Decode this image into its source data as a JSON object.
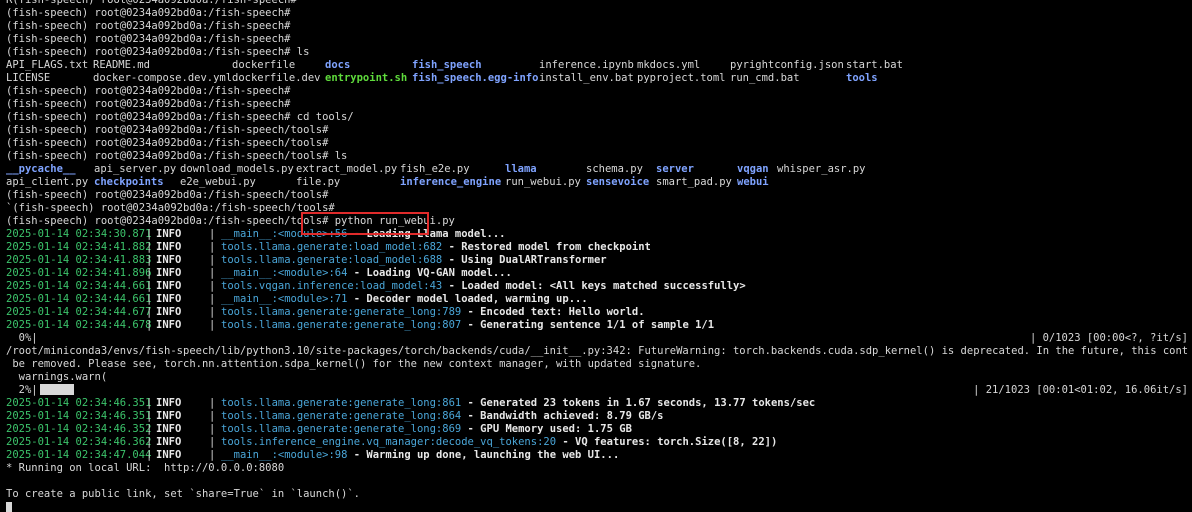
{
  "prompt_lines": [
    "R(fish-speech) root@0234a092bd0a:/fish-speech#",
    "(fish-speech) root@0234a092bd0a:/fish-speech#",
    "(fish-speech) root@0234a092bd0a:/fish-speech#",
    "(fish-speech) root@0234a092bd0a:/fish-speech#",
    "(fish-speech) root@0234a092bd0a:/fish-speech# ls"
  ],
  "ls1": [
    [
      {
        "t": "API_FLAGS.txt",
        "k": "file"
      },
      {
        "t": "README.md",
        "k": "file"
      },
      {
        "t": "dockerfile",
        "k": "file"
      },
      {
        "t": "docs",
        "k": "dir"
      },
      {
        "t": "fish_speech",
        "k": "dir"
      },
      {
        "t": "inference.ipynb",
        "k": "file"
      },
      {
        "t": "mkdocs.yml",
        "k": "file"
      },
      {
        "t": "pyrightconfig.json",
        "k": "file"
      },
      {
        "t": "start.bat",
        "k": "file"
      }
    ],
    [
      {
        "t": "LICENSE",
        "k": "file"
      },
      {
        "t": "docker-compose.dev.yml",
        "k": "file"
      },
      {
        "t": "dockerfile.dev",
        "k": "file"
      },
      {
        "t": "entrypoint.sh",
        "k": "exe"
      },
      {
        "t": "fish_speech.egg-info",
        "k": "dir"
      },
      {
        "t": "install_env.bat",
        "k": "file"
      },
      {
        "t": "pyproject.toml",
        "k": "file"
      },
      {
        "t": "run_cmd.bat",
        "k": "file"
      },
      {
        "t": "tools",
        "k": "dir"
      }
    ]
  ],
  "prompt_lines2": [
    "(fish-speech) root@0234a092bd0a:/fish-speech#",
    "(fish-speech) root@0234a092bd0a:/fish-speech#",
    "(fish-speech) root@0234a092bd0a:/fish-speech# cd tools/",
    "(fish-speech) root@0234a092bd0a:/fish-speech/tools#",
    "(fish-speech) root@0234a092bd0a:/fish-speech/tools#",
    "(fish-speech) root@0234a092bd0a:/fish-speech/tools# ls"
  ],
  "ls2": [
    [
      {
        "t": "__pycache__",
        "k": "dir"
      },
      {
        "t": "api_server.py",
        "k": "file"
      },
      {
        "t": "download_models.py",
        "k": "file"
      },
      {
        "t": "extract_model.py",
        "k": "file"
      },
      {
        "t": "fish_e2e.py",
        "k": "file"
      },
      {
        "t": "llama",
        "k": "dir"
      },
      {
        "t": "schema.py",
        "k": "file"
      },
      {
        "t": "server",
        "k": "dir"
      },
      {
        "t": "vqgan",
        "k": "dir"
      },
      {
        "t": "whisper_asr.py",
        "k": "file"
      }
    ],
    [
      {
        "t": "api_client.py",
        "k": "file"
      },
      {
        "t": "checkpoints",
        "k": "dir"
      },
      {
        "t": "e2e_webui.py",
        "k": "file"
      },
      {
        "t": "file.py",
        "k": "file"
      },
      {
        "t": "inference_engine",
        "k": "dir"
      },
      {
        "t": "run_webui.py",
        "k": "file"
      },
      {
        "t": "sensevoice",
        "k": "dir"
      },
      {
        "t": "smart_pad.py",
        "k": "file"
      },
      {
        "t": "webui",
        "k": "dir"
      }
    ]
  ],
  "prompt_lines3": [
    "(fish-speech) root@0234a092bd0a:/fish-speech/tools#",
    "`(fish-speech) root@0234a092bd0a:/fish-speech/tools#"
  ],
  "run_prompt": "(fish-speech) root@0234a092bd0a:/fish-speech/tools#",
  "run_command": "python run_webui.py",
  "logs1": [
    {
      "ts": "2025-01-14 02:34:30.871",
      "lvl": "INFO",
      "mod": "__main__:<module>:56",
      "msg": "Loading Llama model..."
    },
    {
      "ts": "2025-01-14 02:34:41.882",
      "lvl": "INFO",
      "mod": "tools.llama.generate:load_model:682",
      "msg": "Restored model from checkpoint"
    },
    {
      "ts": "2025-01-14 02:34:41.883",
      "lvl": "INFO",
      "mod": "tools.llama.generate:load_model:688",
      "msg": "Using DualARTransformer"
    },
    {
      "ts": "2025-01-14 02:34:41.896",
      "lvl": "INFO",
      "mod": "__main__:<module>:64",
      "msg": "Loading VQ-GAN model..."
    },
    {
      "ts": "2025-01-14 02:34:44.661",
      "lvl": "INFO",
      "mod": "tools.vqgan.inference:load_model:43",
      "msg": "Loaded model: <All keys matched successfully>"
    },
    {
      "ts": "2025-01-14 02:34:44.661",
      "lvl": "INFO",
      "mod": "__main__:<module>:71",
      "msg": "Decoder model loaded, warming up..."
    },
    {
      "ts": "2025-01-14 02:34:44.677",
      "lvl": "INFO",
      "mod": "tools.llama.generate:generate_long:789",
      "msg": "Encoded text: Hello world."
    },
    {
      "ts": "2025-01-14 02:34:44.678",
      "lvl": "INFO",
      "mod": "tools.llama.generate:generate_long:807",
      "msg": "Generating sentence 1/1 of sample 1/1"
    }
  ],
  "progress0": {
    "left": "  0%|",
    "right": "| 0/1023 [00:00<?, ?it/s]",
    "fraction": 0.0
  },
  "warning_lines": [
    "/root/miniconda3/envs/fish-speech/lib/python3.10/site-packages/torch/backends/cuda/__init__.py:342: FutureWarning: torch.backends.cuda.sdp_kernel() is deprecated. In the future, this context manager will",
    " be removed. Please see, torch.nn.attention.sdpa_kernel() for the new context manager, with updated signature.",
    "  warnings.warn("
  ],
  "progress2": {
    "left": "  2%|",
    "right": "| 21/1023 [00:01<01:02, 16.06it/s]",
    "fraction": 0.02
  },
  "logs2": [
    {
      "ts": "2025-01-14 02:34:46.351",
      "lvl": "INFO",
      "mod": "tools.llama.generate:generate_long:861",
      "msg": "Generated 23 tokens in 1.67 seconds, 13.77 tokens/sec"
    },
    {
      "ts": "2025-01-14 02:34:46.351",
      "lvl": "INFO",
      "mod": "tools.llama.generate:generate_long:864",
      "msg": "Bandwidth achieved: 8.79 GB/s"
    },
    {
      "ts": "2025-01-14 02:34:46.352",
      "lvl": "INFO",
      "mod": "tools.llama.generate:generate_long:869",
      "msg": "GPU Memory used: 1.75 GB"
    },
    {
      "ts": "2025-01-14 02:34:46.362",
      "lvl": "INFO",
      "mod": "tools.inference_engine.vq_manager:decode_vq_tokens:20",
      "msg": "VQ features: torch.Size([8, 22])"
    },
    {
      "ts": "2025-01-14 02:34:47.044",
      "lvl": "INFO",
      "mod": "__main__:<module>:98",
      "msg": "Warming up done, launching the web UI..."
    }
  ],
  "running_line": "* Running on local URL:  http://0.0.0.0:8080",
  "public_link_line": "To create a public link, set `share=True` in `launch()`."
}
